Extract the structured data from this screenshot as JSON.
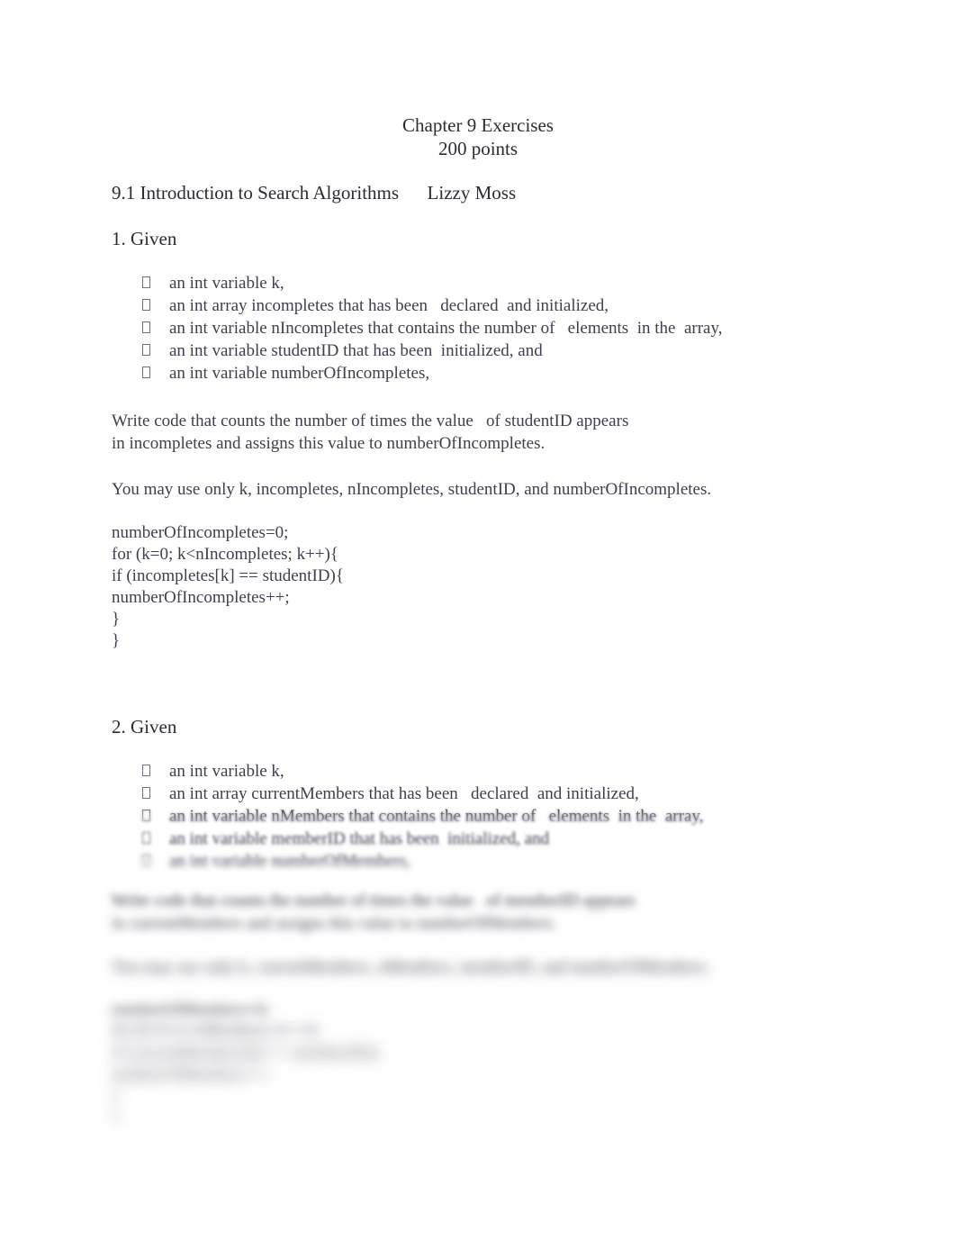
{
  "document": {
    "title_line1": "Chapter 9 Exercises",
    "title_line2": "200 points",
    "section_heading": "9.1 Introduction to Search Algorithms      Lizzy Moss"
  },
  "question1": {
    "heading": "1. Given",
    "bullets": [
      "an int variable k,",
      "an int array incompletes that has been   declared  and initialized,",
      "an int variable nIncompletes that contains the number of   elements  in the  array,",
      "an int variable studentID that has been  initialized, and",
      "an int variable numberOfIncompletes,"
    ],
    "paragraph1": "Write code that counts the number of times the value   of studentID appears\nin incompletes and assigns this value to numberOfIncompletes.",
    "paragraph2": "You may use only k, incompletes, nIncompletes, studentID, and numberOfIncompletes.",
    "code": "numberOfIncompletes=0;\nfor (k=0; k<nIncompletes; k++){\nif (incompletes[k] == studentID){\nnumberOfIncompletes++;\n}\n}"
  },
  "question2": {
    "heading": "2. Given",
    "bullets": [
      "an int variable k,",
      "an int array currentMembers that has been   declared  and initialized,",
      "an int variable nMembers that contains the number of   elements  in the  array,",
      "an int variable memberID that has been  initialized, and",
      "an int variable numberOfMembers,"
    ],
    "paragraph1": "Write code that counts the number of times the value   of memberID appears\nin currentMembers and assigns this value to numberOfMembers.",
    "paragraph2": "You may use only k, currentMembers, nMembers, memberID, and numberOfMembers.",
    "code": "numberOfMembers=0;\nfor (k=0; k<nMembers; k++){\nif (currentMembers[k] == memberID){\nnumberOfMembers++;\n}\n}"
  },
  "bullet_glyph": "tofu-box-missing-glyph"
}
